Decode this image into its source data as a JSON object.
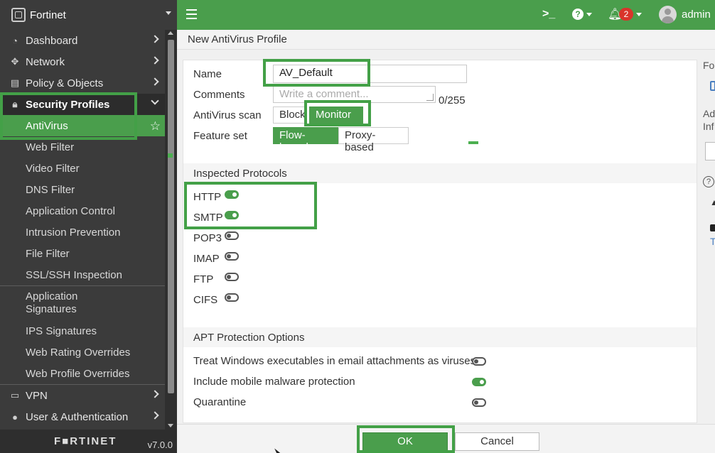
{
  "app": {
    "title": "Fortinet",
    "version": "v7.0.0",
    "footer_logo": "F■RTINET"
  },
  "topbar": {
    "user": "admin",
    "notifications": "2",
    "cli_icon": "cli-icon",
    "help_icon": "help-icon",
    "bell_icon": "bell-icon"
  },
  "page": {
    "title": "New AntiVirus Profile"
  },
  "sidebar": {
    "items": [
      {
        "label": "Dashboard",
        "icon": "dashboard-icon"
      },
      {
        "label": "Network",
        "icon": "network-icon"
      },
      {
        "label": "Policy & Objects",
        "icon": "policy-icon"
      },
      {
        "label": "Security Profiles",
        "icon": "lock-icon"
      },
      {
        "label": "VPN",
        "icon": "vpn-icon"
      },
      {
        "label": "User & Authentication",
        "icon": "user-icon"
      }
    ],
    "security_profiles": [
      "AntiVirus",
      "Web Filter",
      "Video Filter",
      "DNS Filter",
      "Application Control",
      "Intrusion Prevention",
      "File Filter",
      "SSL/SSH Inspection"
    ],
    "signatures": [
      "Application\nSignatures",
      "IPS Signatures",
      "Web Rating Overrides",
      "Web Profile Overrides"
    ]
  },
  "form": {
    "name_label": "Name",
    "name_value": "AV_Default",
    "comments_label": "Comments",
    "comments_placeholder": "Write a comment...",
    "comments_counter": "0/255",
    "scan_label": "AntiVirus scan",
    "scan_block": "Block",
    "scan_monitor": "Monitor",
    "scan_selected": "Monitor",
    "feature_label": "Feature set",
    "feature_flow": "Flow-based",
    "feature_proxy": "Proxy-based",
    "feature_selected": "Flow-based"
  },
  "inspected_protocols": {
    "title": "Inspected Protocols",
    "items": [
      {
        "label": "HTTP",
        "enabled": true
      },
      {
        "label": "SMTP",
        "enabled": true
      },
      {
        "label": "POP3",
        "enabled": false
      },
      {
        "label": "IMAP",
        "enabled": false
      },
      {
        "label": "FTP",
        "enabled": false
      },
      {
        "label": "CIFS",
        "enabled": false
      }
    ]
  },
  "apt": {
    "title": "APT Protection Options",
    "items": [
      {
        "label": "Treat Windows executables in email attachments as viruses",
        "enabled": false
      },
      {
        "label": "Include mobile malware protection",
        "enabled": true
      },
      {
        "label": "Quarantine",
        "enabled": false
      }
    ]
  },
  "buttons": {
    "ok": "OK",
    "cancel": "Cancel"
  },
  "right_panel": {
    "line1": "Fo",
    "line2": "Ad",
    "line3": "Inf",
    "line4": "T"
  },
  "colors": {
    "accent": "#4a9e4c",
    "sidebar": "#3b3b3b",
    "highlight": "#43a047",
    "badge": "#d9342b"
  }
}
